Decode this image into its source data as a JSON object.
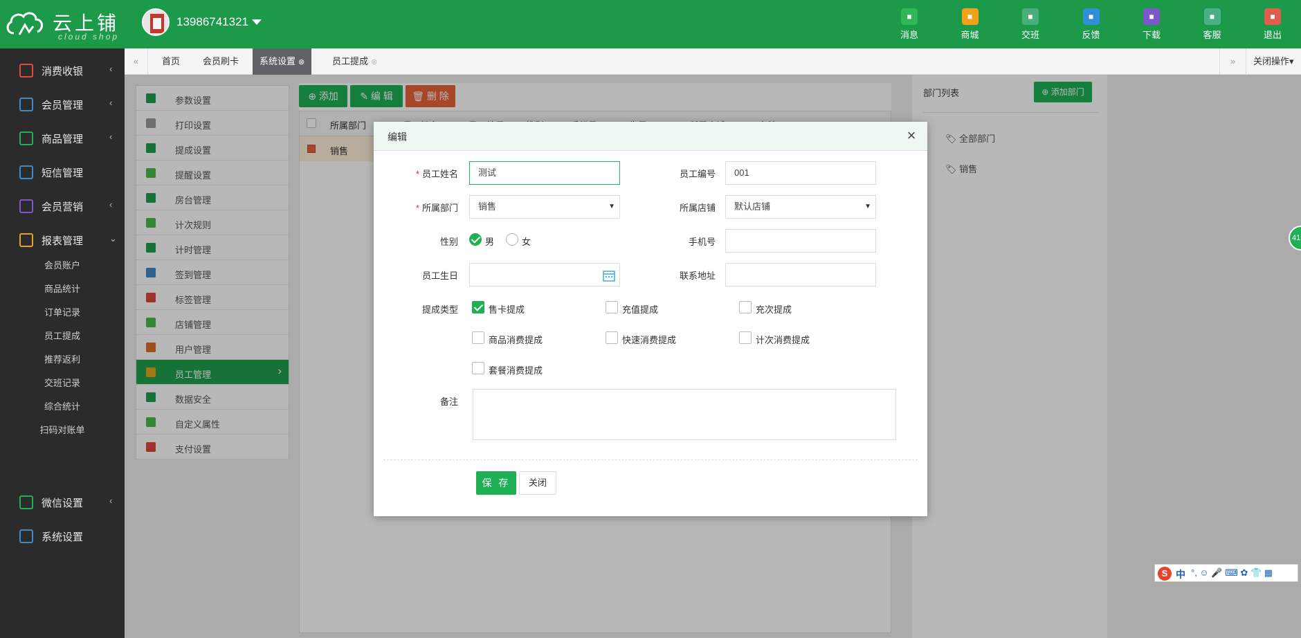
{
  "header": {
    "logo_text": "云上铺",
    "logo_sub": "cloud shop",
    "phone": "13986741321",
    "buttons": [
      {
        "label": "消息",
        "icon": "paper-plane-icon",
        "color": "#2fb657"
      },
      {
        "label": "商城",
        "icon": "store-icon",
        "color": "#f0a21a"
      },
      {
        "label": "交班",
        "icon": "swap-icon",
        "color": "#47b07a"
      },
      {
        "label": "反馈",
        "icon": "chat-icon",
        "color": "#2f8fd8"
      },
      {
        "label": "下载",
        "icon": "download-icon",
        "color": "#7b57c9"
      },
      {
        "label": "客服",
        "icon": "customer-service-icon",
        "color": "#4cae84"
      },
      {
        "label": "退出",
        "icon": "power-icon",
        "color": "#e05d4d"
      }
    ]
  },
  "sidebar": {
    "items": [
      {
        "label": "消费收银",
        "icon": "register-icon",
        "chevron": "‹"
      },
      {
        "label": "会员管理",
        "icon": "members-icon",
        "chevron": "‹"
      },
      {
        "label": "商品管理",
        "icon": "goods-icon",
        "chevron": "‹"
      },
      {
        "label": "短信管理",
        "icon": "sms-icon",
        "chevron": ""
      },
      {
        "label": "会员营销",
        "icon": "gift-icon",
        "chevron": "‹"
      },
      {
        "label": "报表管理",
        "icon": "report-icon",
        "chevron": "⌄"
      },
      {
        "label": "微信设置",
        "icon": "wechat-icon",
        "chevron": "‹"
      },
      {
        "label": "系统设置",
        "icon": "settings-icon",
        "chevron": ""
      }
    ],
    "report_sub": [
      "会员账户",
      "商品统计",
      "订单记录",
      "员工提成",
      "推荐返利",
      "交班记录",
      "综合统计",
      "扫码对账单"
    ]
  },
  "tabs": {
    "nav_prev": "«",
    "nav_next": "»",
    "items": [
      {
        "label": "首页"
      },
      {
        "label": "会员刷卡"
      },
      {
        "label": "系统设置"
      },
      {
        "label": "员工提成"
      }
    ],
    "close_ops": "关闭操作"
  },
  "settings_menu": {
    "items": [
      {
        "label": "参数设置",
        "color": "#1f9e4d"
      },
      {
        "label": "打印设置",
        "color": "#9a9a9a"
      },
      {
        "label": "提成设置",
        "color": "#1f9e4d"
      },
      {
        "label": "提醒设置",
        "color": "#4cbb47"
      },
      {
        "label": "房台管理",
        "color": "#1f9e4d"
      },
      {
        "label": "计次规则",
        "color": "#4cbb47"
      },
      {
        "label": "计时管理",
        "color": "#1f9e4d"
      },
      {
        "label": "签到管理",
        "color": "#3e8bc7"
      },
      {
        "label": "标签管理",
        "color": "#e0493b"
      },
      {
        "label": "店铺管理",
        "color": "#4cbb47"
      },
      {
        "label": "用户管理",
        "color": "#e06c2c"
      },
      {
        "label": "员工管理",
        "color": "#e0a81f"
      },
      {
        "label": "数据安全",
        "color": "#1f9e4d"
      },
      {
        "label": "自定义属性",
        "color": "#4cbb47"
      },
      {
        "label": "支付设置",
        "color": "#e0493b"
      }
    ]
  },
  "toolbar": {
    "add": "添加",
    "edit": "编 辑",
    "delete": "删 除"
  },
  "grid": {
    "columns": [
      "所属部门",
      "员工姓名",
      "员工编号",
      "性别",
      "手机号",
      "生日",
      "所属店铺",
      "备注"
    ],
    "rows": [
      [
        "销售"
      ]
    ]
  },
  "right_panel": {
    "title": "部门列表",
    "add_dept": "添加部门",
    "depts": [
      "全部部门",
      "销售"
    ]
  },
  "modal": {
    "title": "编辑",
    "fields": {
      "name_label": "员工姓名",
      "name_value": "测试",
      "no_label": "员工编号",
      "no_value": "001",
      "dept_label": "所属部门",
      "dept_value": "销售",
      "store_label": "所属店铺",
      "store_value": "默认店铺",
      "gender_label": "性别",
      "gender_male": "男",
      "gender_female": "女",
      "mobile_label": "手机号",
      "birthday_label": "员工生日",
      "address_label": "联系地址",
      "commission_label": "提成类型",
      "remark_label": "备注"
    },
    "commission_types": [
      {
        "label": "售卡提成",
        "checked": true
      },
      {
        "label": "充值提成",
        "checked": false
      },
      {
        "label": "充次提成",
        "checked": false
      },
      {
        "label": "商品消费提成",
        "checked": false
      },
      {
        "label": "快速消费提成",
        "checked": false
      },
      {
        "label": "计次消费提成",
        "checked": false
      },
      {
        "label": "套餐消费提成",
        "checked": false
      }
    ],
    "save": "保 存",
    "close": "关闭"
  },
  "float_ball": "41",
  "ime_bar": {
    "lang": "中"
  }
}
